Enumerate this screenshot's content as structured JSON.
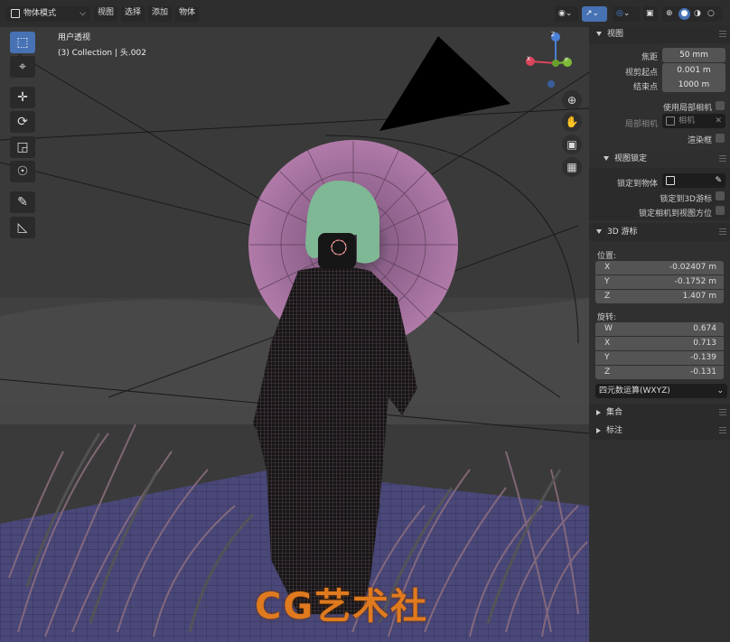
{
  "header": {
    "mode_label": "物体模式",
    "menu": [
      "视图",
      "选择",
      "添加",
      "物体"
    ]
  },
  "viewport": {
    "view_name": "用户透视",
    "collection_info": "(3) Collection | 头.002",
    "gizmo_axes": [
      "Z",
      "X",
      "Y"
    ],
    "watermark": "CG艺术社"
  },
  "toolbar": {
    "tools": [
      "select-box-icon",
      "cursor-icon",
      "move-icon",
      "rotate-icon",
      "scale-icon",
      "transform-icon",
      "annotate-icon",
      "measure-icon"
    ]
  },
  "panel": {
    "view_section": {
      "title": "视图",
      "focal_label": "焦距",
      "focal_value": "50 mm",
      "clip_start_label": "视剪起点",
      "clip_start_value": "0.001 m",
      "clip_end_label": "结束点",
      "clip_end_value": "1000 m",
      "local_camera_label": "使用局部相机",
      "local_camera_field_label": "局部相机",
      "camera_placeholder": "相机",
      "render_region_label": "渲染框"
    },
    "view_lock": {
      "title": "视图锁定",
      "lock_object_label": "锁定到物体",
      "lock_cursor_label": "锁定到3D游标",
      "lock_camera_label": "锁定相机到视图方位"
    },
    "cursor_section": {
      "title": "3D 游标",
      "location_label": "位置:",
      "location": [
        {
          "axis": "X",
          "value": "-0.02407 m"
        },
        {
          "axis": "Y",
          "value": "-0.1752 m"
        },
        {
          "axis": "Z",
          "value": "1.407 m"
        }
      ],
      "rotation_label": "旋转:",
      "rotation": [
        {
          "axis": "W",
          "value": "0.674"
        },
        {
          "axis": "X",
          "value": "0.713"
        },
        {
          "axis": "Y",
          "value": "-0.139"
        },
        {
          "axis": "Z",
          "value": "-0.131"
        }
      ],
      "rotation_mode": "四元数运算(WXYZ)"
    },
    "collections_title": "集合",
    "annotations_title": "标注"
  },
  "colors": {
    "accent": "#4772b3",
    "halo": "#b07aa8",
    "hair": "#7fb894",
    "watermark": "#e07a1e"
  }
}
